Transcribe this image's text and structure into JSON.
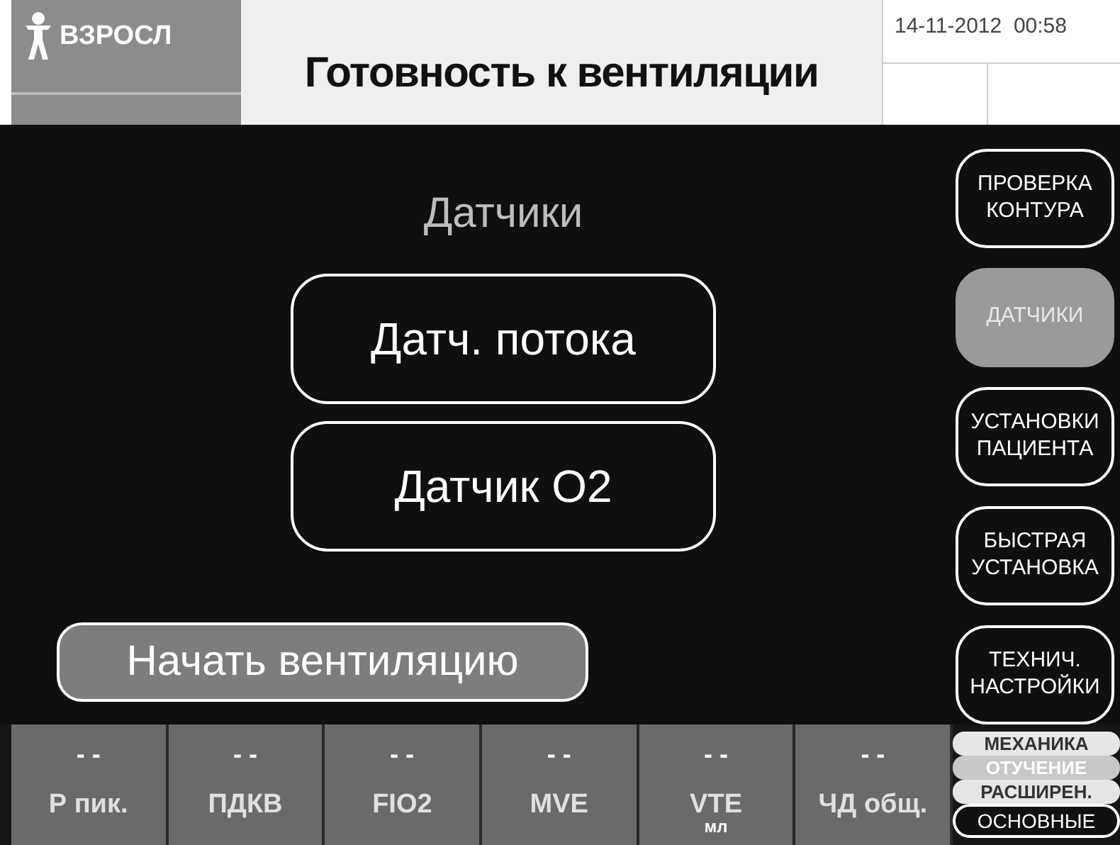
{
  "header": {
    "patient_mode": "ВЗРОСЛ",
    "title": "Готовность к вентиляции",
    "datetime": "14-11-2012  00:58"
  },
  "panel": {
    "title": "Датчики",
    "buttons": [
      "Датч. потока",
      "Датчик O2"
    ],
    "start_button": "Начать вентиляцию"
  },
  "side_menu": [
    {
      "label": "ПРОВЕРКА КОНТУРА",
      "selected": false
    },
    {
      "label": "ДАТЧИКИ",
      "selected": true
    },
    {
      "label": "УСТАНОВКИ ПАЦИЕНТА",
      "selected": false
    },
    {
      "label": "БЫСТРАЯ УСТАНОВКА",
      "selected": false
    },
    {
      "label": "ТЕХНИЧ. НАСТРОЙКИ",
      "selected": false
    }
  ],
  "parameters": [
    {
      "value": "- -",
      "label": "Р пик."
    },
    {
      "value": "- -",
      "label": "ПДКВ"
    },
    {
      "value": "- -",
      "label": "FIO2"
    },
    {
      "value": "- -",
      "label": "MVE"
    },
    {
      "value": "- -",
      "label": "VTE",
      "unit": "мл"
    },
    {
      "value": "- -",
      "label": "ЧД общ."
    }
  ],
  "view_tabs": [
    {
      "label": "МЕХАНИКА",
      "selected": false,
      "disabled": false
    },
    {
      "label": "ОТУЧЕНИЕ",
      "selected": false,
      "disabled": true
    },
    {
      "label": "РАСШИРЕН.",
      "selected": false,
      "disabled": false
    },
    {
      "label": "ОСНОВНЫЕ",
      "selected": true,
      "disabled": false
    }
  ]
}
